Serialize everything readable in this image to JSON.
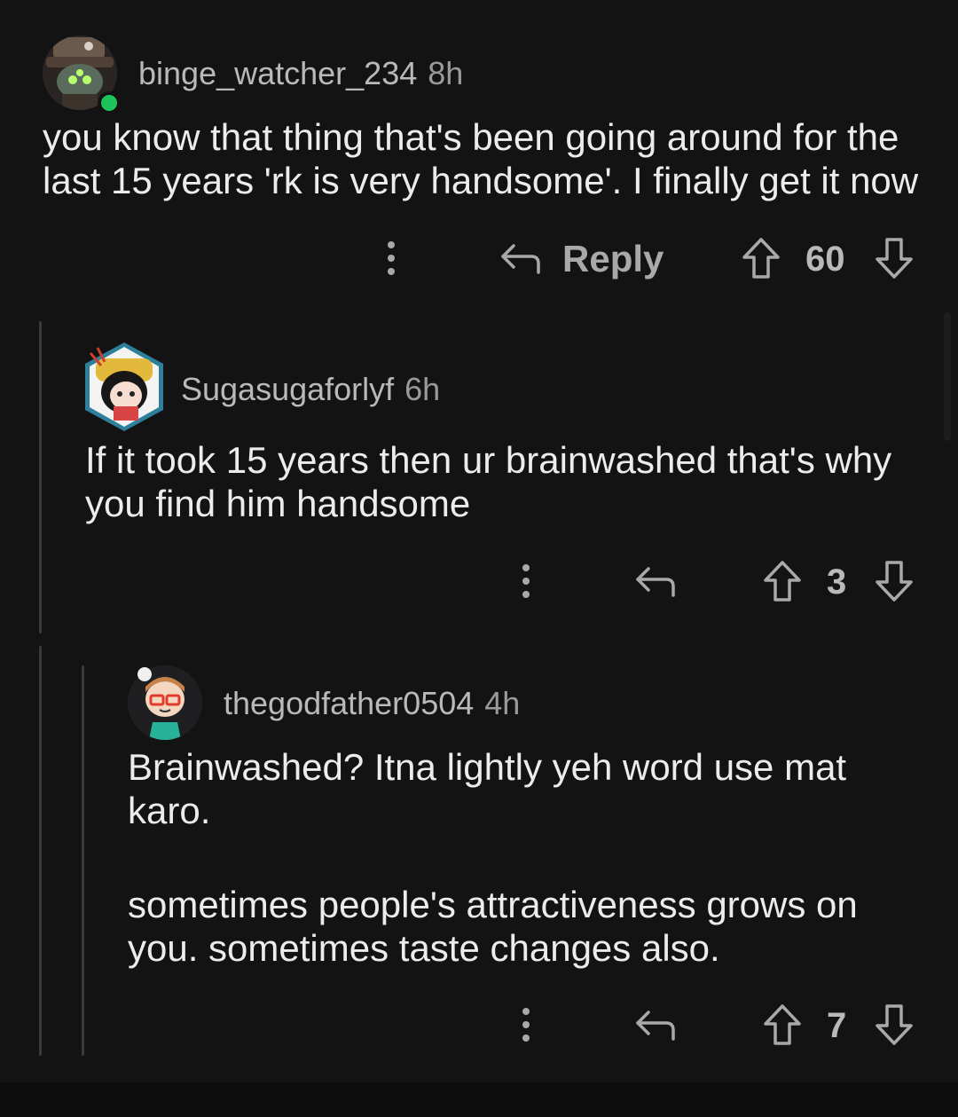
{
  "comments": [
    {
      "username": "binge_watcher_234",
      "time": "8h",
      "body_lines": [
        "you know that thing that's been going around for the",
        "last 15 years 'rk is very handsome'. I finally get it now"
      ],
      "reply_label": "Reply",
      "votes": "60"
    },
    {
      "username": "Sugasugaforlyf",
      "time": "6h",
      "body_lines": [
        "If it took 15 years then ur brainwashed that's why",
        "you find him handsome"
      ],
      "votes": "3"
    },
    {
      "username": "thegodfather0504",
      "time": "4h",
      "body_lines": [
        "Brainwashed? Itna lightly yeh word use mat",
        "karo.",
        "sometimes people's attractiveness grows on",
        "you. sometimes taste changes also."
      ],
      "votes": "7"
    }
  ],
  "icons": {
    "more": "more-vertical-icon",
    "reply": "reply-arrow-icon",
    "upvote": "upvote-arrow-icon",
    "downvote": "downvote-arrow-icon",
    "online": "online-status-icon"
  },
  "colors": {
    "background": "#131314",
    "text": "#ececee",
    "meta": "#b9b9bb",
    "icon": "#a9a9ab",
    "online": "#1fc35c",
    "thread_line": "#3a3a3c"
  }
}
